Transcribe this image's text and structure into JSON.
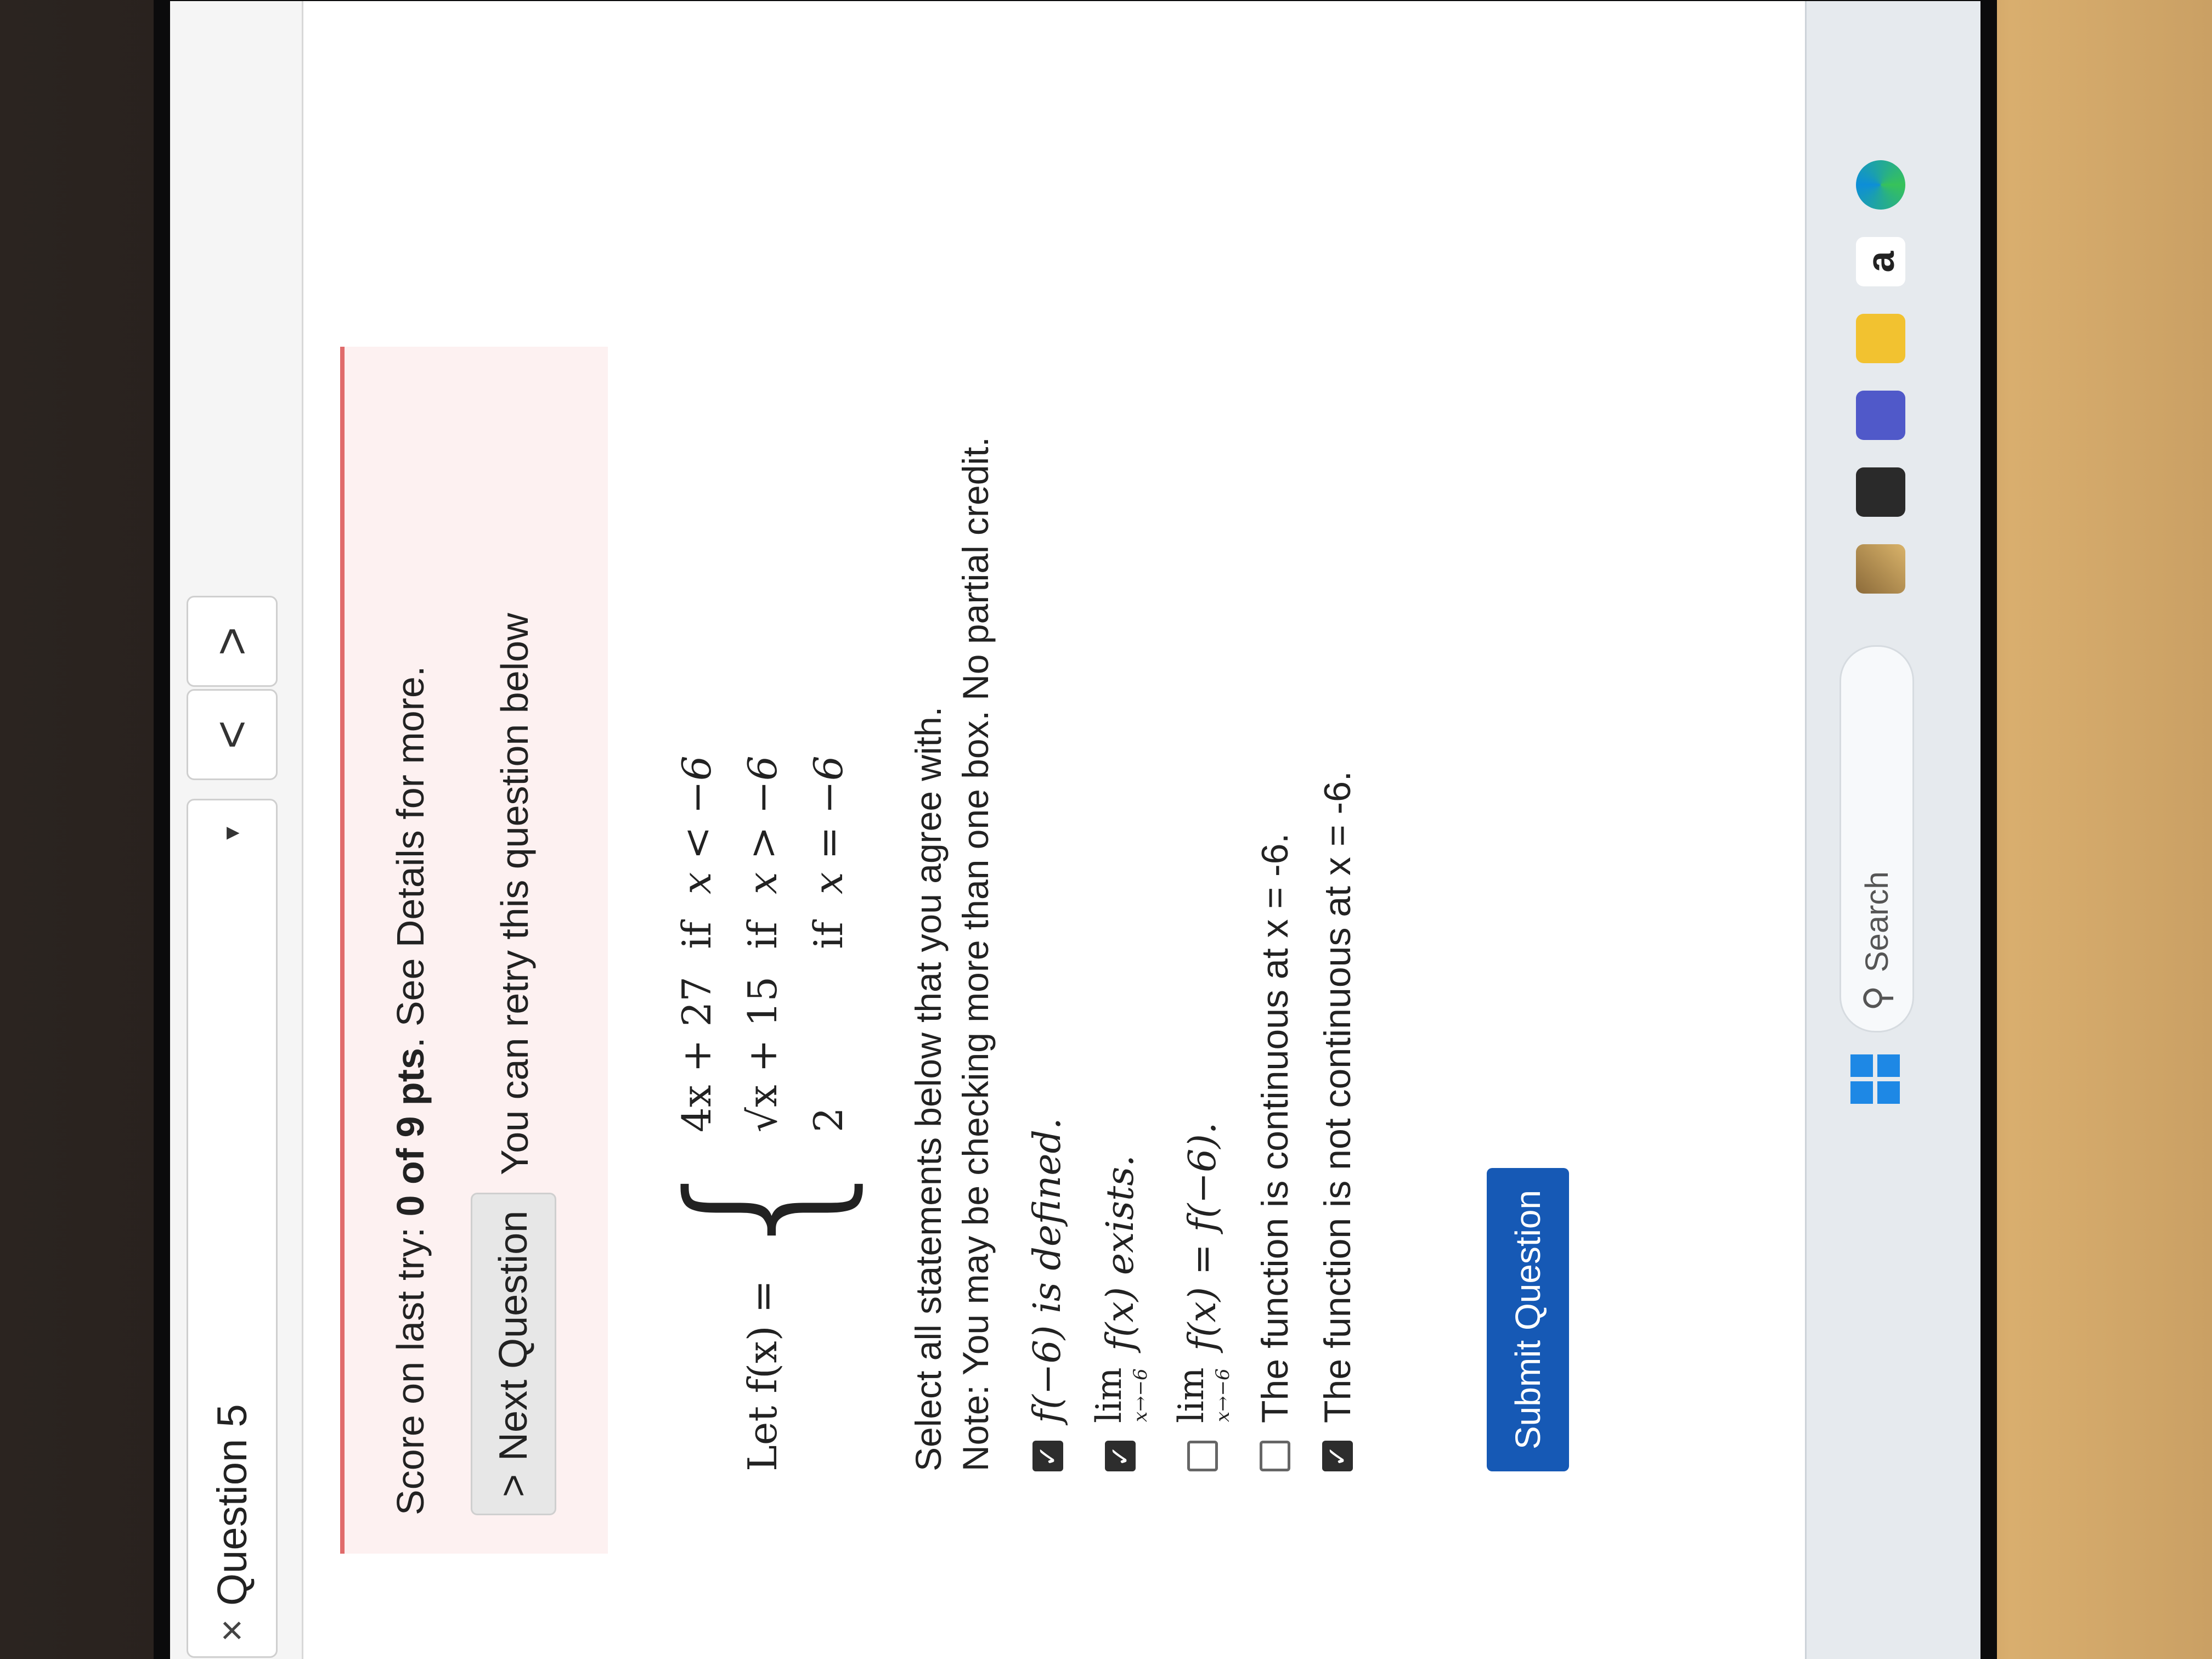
{
  "header": {
    "close_glyph": "×",
    "question_title": "Question 5",
    "dropdown_caret": "▼",
    "prev_glyph": "<",
    "next_glyph": ">"
  },
  "score": {
    "prefix": "Score on last try: ",
    "score_value": "0 of 9 pts",
    "suffix": ". See Details for more."
  },
  "next_question": {
    "chevron": ">",
    "label": "Next Question"
  },
  "retry_text": "You can retry this question below",
  "formula": {
    "lhs": "Let f(x) =",
    "cases": [
      {
        "expr": "4x + 27",
        "if": "if",
        "cond": "x < −6"
      },
      {
        "expr": "√x + 15",
        "if": "if",
        "cond": "x > −6"
      },
      {
        "expr": "2",
        "if": "if",
        "cond": "x = −6"
      }
    ]
  },
  "instructions": {
    "line1": "Select all statements below that you agree with.",
    "line2": "Note: You may be checking more than one box. No partial credit."
  },
  "options": [
    {
      "lim": "",
      "lim_sub": "",
      "text": "f(−6) is defined.",
      "checked": true
    },
    {
      "lim": "lim",
      "lim_sub": "x→−6",
      "text": "f(x) exists.",
      "checked": true
    },
    {
      "lim": "lim",
      "lim_sub": "x→−6",
      "text": "f(x) = f(−6).",
      "checked": false
    },
    {
      "lim": "",
      "lim_sub": "",
      "text": "The function is continuous at x = -6.",
      "checked": false
    },
    {
      "lim": "",
      "lim_sub": "",
      "text": "The function is not continuous at x = -6.",
      "checked": true
    }
  ],
  "check_glyph": "✓",
  "submit_label": "Submit Question",
  "taskbar": {
    "search_icon_glyph": "⚲",
    "search_label": "Search",
    "amazon_letter": "a"
  }
}
